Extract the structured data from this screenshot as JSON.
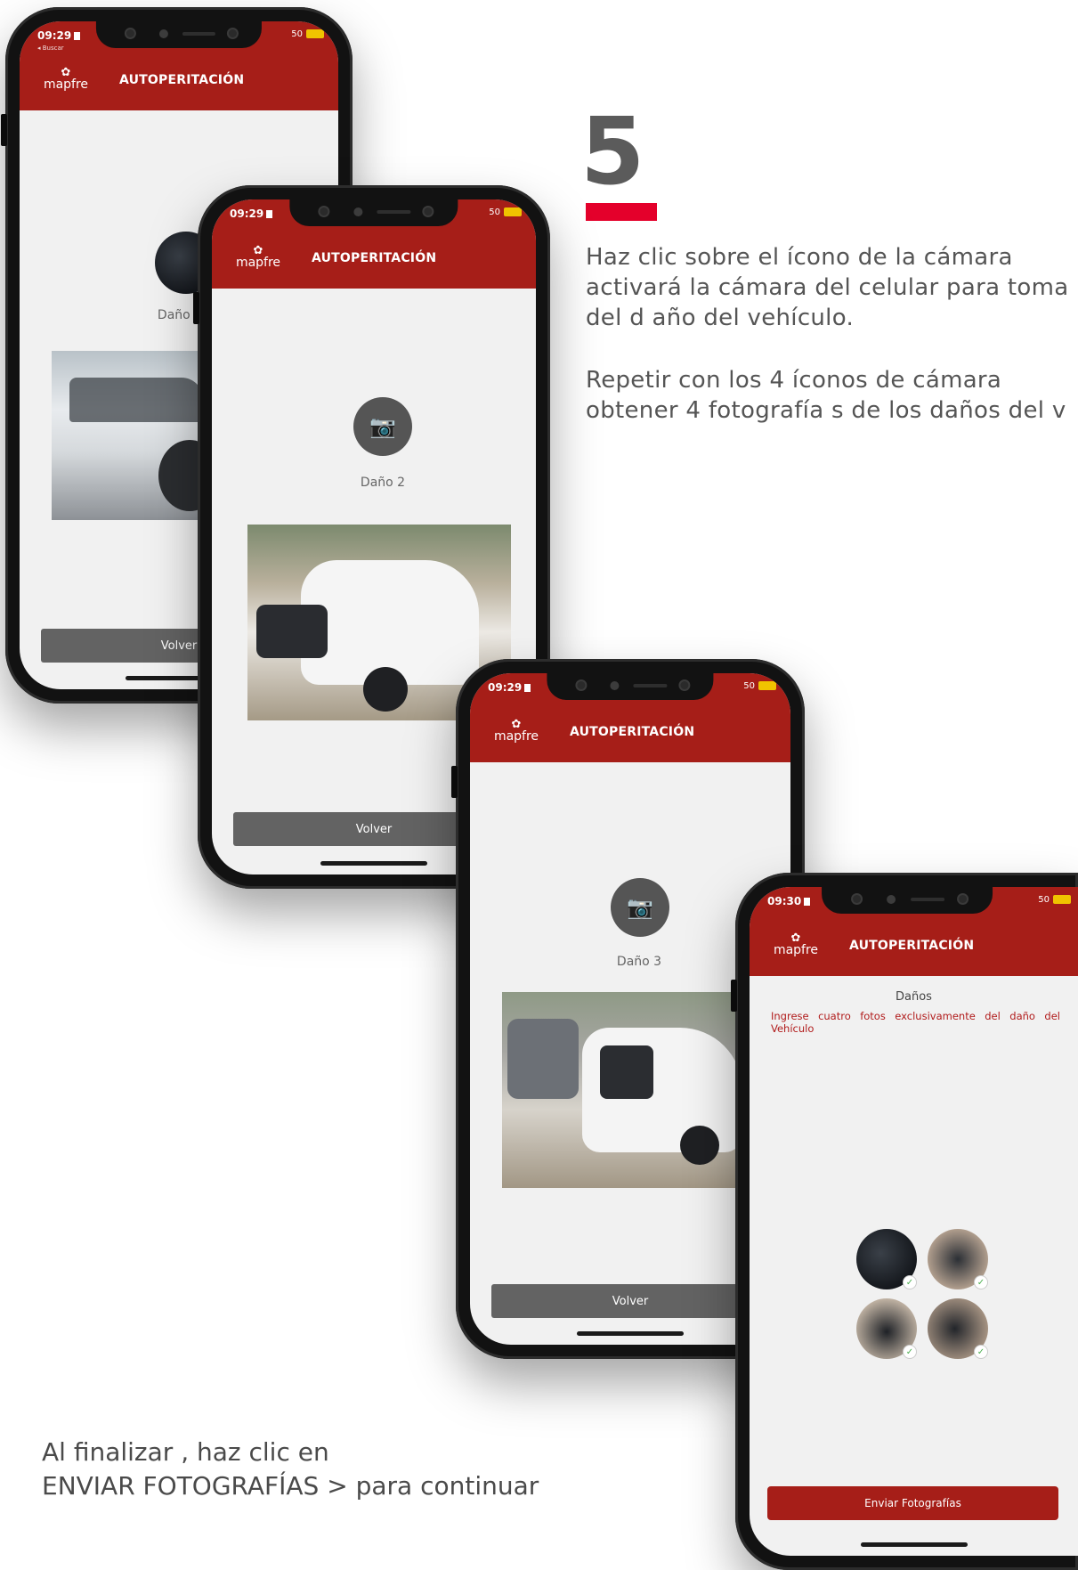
{
  "step": {
    "number": "5",
    "paragraph1": [
      "Haz clic sobre el ícono de la cámara",
      "activará la cámara del celular para toma",
      "del d año del vehículo."
    ],
    "paragraph2": [
      "Repetir con los 4 íconos de cámara",
      "obtener 4 fotografía s de los daños del v"
    ]
  },
  "footer": {
    "line1": "Al finalizar , haz clic en",
    "line2": "ENVIAR FOTOGRAFÍAS > para continuar"
  },
  "app": {
    "logo_text": "mapfre",
    "title": "AUTOPERITACIÓN",
    "back_label": "◂ Buscar",
    "signal": "50"
  },
  "phones": [
    {
      "time": "09:29",
      "damage_label": "Daño 1",
      "back_button": "Volver"
    },
    {
      "time": "09:29",
      "damage_label": "Daño 2",
      "back_button": "Volver"
    },
    {
      "time": "09:29",
      "damage_label": "Daño 3",
      "back_button": "Volver"
    },
    {
      "time": "09:30",
      "section_title": "Daños",
      "instruction": "Ingrese cuatro fotos exclusivamente del daño del Vehículo",
      "submit_button": "Enviar Fotografías"
    }
  ],
  "colors": {
    "brand_red": "#a61e18",
    "accent_red": "#e4002b",
    "button_gray": "#636363"
  },
  "icons": {
    "camera": "camera-icon",
    "check": "check-icon",
    "logo_mark": "mapfre-logo-icon"
  }
}
